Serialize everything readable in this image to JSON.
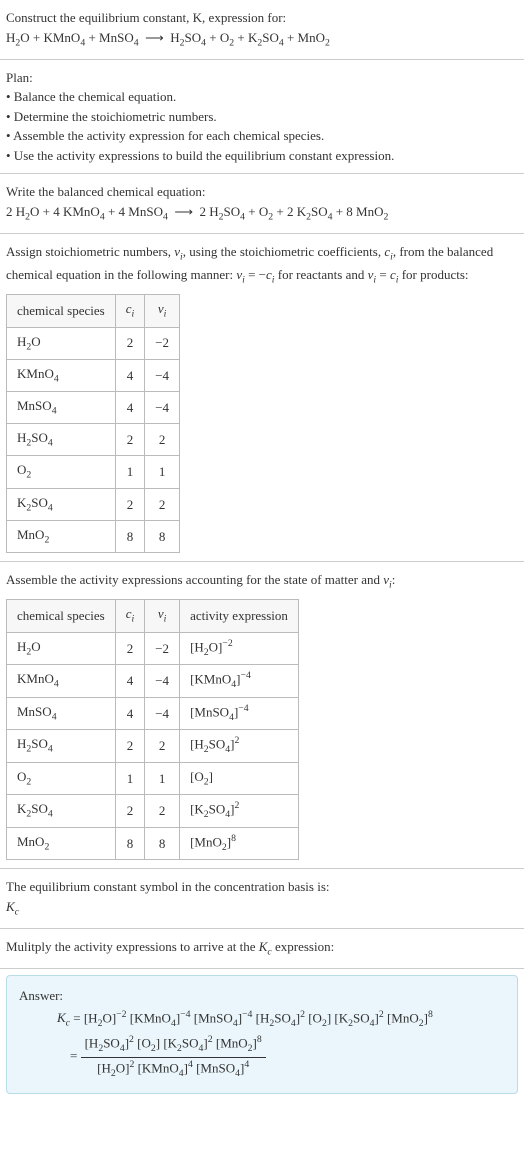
{
  "intro": {
    "line1": "Construct the equilibrium constant, K, expression for:",
    "equation": "H₂O + KMnO₄ + MnSO₄  ⟶  H₂SO₄ + O₂ + K₂SO₄ + MnO₂"
  },
  "plan": {
    "heading": "Plan:",
    "items": [
      "• Balance the chemical equation.",
      "• Determine the stoichiometric numbers.",
      "• Assemble the activity expression for each chemical species.",
      "• Use the activity expressions to build the equilibrium constant expression."
    ]
  },
  "balanced": {
    "heading": "Write the balanced chemical equation:",
    "equation": "2 H₂O + 4 KMnO₄ + 4 MnSO₄  ⟶  2 H₂SO₄ + O₂ + 2 K₂SO₄ + 8 MnO₂"
  },
  "assign": {
    "text": "Assign stoichiometric numbers, νᵢ, using the stoichiometric coefficients, cᵢ, from the balanced chemical equation in the following manner: νᵢ = −cᵢ for reactants and νᵢ = cᵢ for products:",
    "headers": [
      "chemical species",
      "cᵢ",
      "νᵢ"
    ],
    "rows": [
      [
        "H₂O",
        "2",
        "−2"
      ],
      [
        "KMnO₄",
        "4",
        "−4"
      ],
      [
        "MnSO₄",
        "4",
        "−4"
      ],
      [
        "H₂SO₄",
        "2",
        "2"
      ],
      [
        "O₂",
        "1",
        "1"
      ],
      [
        "K₂SO₄",
        "2",
        "2"
      ],
      [
        "MnO₂",
        "8",
        "8"
      ]
    ]
  },
  "activity": {
    "text": "Assemble the activity expressions accounting for the state of matter and νᵢ:",
    "headers": [
      "chemical species",
      "cᵢ",
      "νᵢ",
      "activity expression"
    ],
    "rows": [
      [
        "H₂O",
        "2",
        "−2",
        "[H₂O]⁻²"
      ],
      [
        "KMnO₄",
        "4",
        "−4",
        "[KMnO₄]⁻⁴"
      ],
      [
        "MnSO₄",
        "4",
        "−4",
        "[MnSO₄]⁻⁴"
      ],
      [
        "H₂SO₄",
        "2",
        "2",
        "[H₂SO₄]²"
      ],
      [
        "O₂",
        "1",
        "1",
        "[O₂]"
      ],
      [
        "K₂SO₄",
        "2",
        "2",
        "[K₂SO₄]²"
      ],
      [
        "MnO₂",
        "8",
        "8",
        "[MnO₂]⁸"
      ]
    ]
  },
  "symbol": {
    "line1": "The equilibrium constant symbol in the concentration basis is:",
    "line2": "K_c"
  },
  "multiply": {
    "text": "Mulitply the activity expressions to arrive at the K_c expression:"
  },
  "answer": {
    "label": "Answer:",
    "line1": "K_c = [H₂O]⁻² [KMnO₄]⁻⁴ [MnSO₄]⁻⁴ [H₂SO₄]² [O₂] [K₂SO₄]² [MnO₂]⁸",
    "eq_prefix": "= ",
    "frac_num": "[H₂SO₄]² [O₂] [K₂SO₄]² [MnO₂]⁸",
    "frac_den": "[H₂O]² [KMnO₄]⁴ [MnSO₄]⁴"
  },
  "chart_data": {
    "type": "table",
    "tables": [
      {
        "title": "Stoichiometric numbers",
        "columns": [
          "chemical species",
          "c_i",
          "ν_i"
        ],
        "rows": [
          {
            "species": "H2O",
            "c_i": 2,
            "nu_i": -2
          },
          {
            "species": "KMnO4",
            "c_i": 4,
            "nu_i": -4
          },
          {
            "species": "MnSO4",
            "c_i": 4,
            "nu_i": -4
          },
          {
            "species": "H2SO4",
            "c_i": 2,
            "nu_i": 2
          },
          {
            "species": "O2",
            "c_i": 1,
            "nu_i": 1
          },
          {
            "species": "K2SO4",
            "c_i": 2,
            "nu_i": 2
          },
          {
            "species": "MnO2",
            "c_i": 8,
            "nu_i": 8
          }
        ]
      },
      {
        "title": "Activity expressions",
        "columns": [
          "chemical species",
          "c_i",
          "ν_i",
          "activity expression"
        ],
        "rows": [
          {
            "species": "H2O",
            "c_i": 2,
            "nu_i": -2,
            "activity": "[H2O]^-2"
          },
          {
            "species": "KMnO4",
            "c_i": 4,
            "nu_i": -4,
            "activity": "[KMnO4]^-4"
          },
          {
            "species": "MnSO4",
            "c_i": 4,
            "nu_i": -4,
            "activity": "[MnSO4]^-4"
          },
          {
            "species": "H2SO4",
            "c_i": 2,
            "nu_i": 2,
            "activity": "[H2SO4]^2"
          },
          {
            "species": "O2",
            "c_i": 1,
            "nu_i": 1,
            "activity": "[O2]"
          },
          {
            "species": "K2SO4",
            "c_i": 2,
            "nu_i": 2,
            "activity": "[K2SO4]^2"
          },
          {
            "species": "MnO2",
            "c_i": 8,
            "nu_i": 8,
            "activity": "[MnO2]^8"
          }
        ]
      }
    ]
  }
}
